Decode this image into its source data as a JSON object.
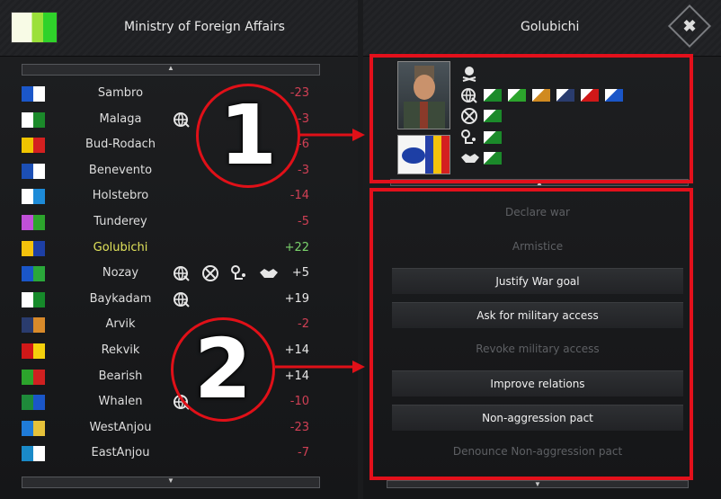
{
  "left_panel": {
    "title": "Ministry of Foreign Affairs"
  },
  "right_panel": {
    "title": "Golubichi",
    "close_label": "✖"
  },
  "countries": [
    {
      "name": "Sambro",
      "value": "-23",
      "sign": "neg",
      "flag_colors": [
        "#1b57c9",
        "#ffffff"
      ],
      "icons": []
    },
    {
      "name": "Malaga",
      "value": "-3",
      "sign": "neg",
      "flag_colors": [
        "#ffffff",
        "#1b8a2a"
      ],
      "icons": [
        "globe-icon"
      ]
    },
    {
      "name": "Bud-Rodach",
      "value": "-6",
      "sign": "neg",
      "flag_colors": [
        "#f0c400",
        "#d42020"
      ],
      "icons": []
    },
    {
      "name": "Benevento",
      "value": "-3",
      "sign": "neg",
      "flag_colors": [
        "#1c4fb5",
        "#ffffff"
      ],
      "icons": []
    },
    {
      "name": "Holstebro",
      "value": "-14",
      "sign": "neg",
      "flag_colors": [
        "#ffffff",
        "#1d8bd8"
      ],
      "icons": []
    },
    {
      "name": "Tunderey",
      "value": "-5",
      "sign": "neg",
      "flag_colors": [
        "#c050d8",
        "#2ca42c"
      ],
      "icons": []
    },
    {
      "name": "Golubichi",
      "value": "+22",
      "sign": "hl",
      "flag_colors": [
        "#f4c20c",
        "#1d3fa5"
      ],
      "icons": []
    },
    {
      "name": "Nozay",
      "value": "+5",
      "sign": "pos",
      "flag_colors": [
        "#1a56c8",
        "#2aa83a"
      ],
      "icons": [
        "globe-icon",
        "crossed-swords-icon",
        "access-pin-icon",
        "handshake-icon"
      ]
    },
    {
      "name": "Baykadam",
      "value": "+19",
      "sign": "pos",
      "flag_colors": [
        "#ffffff",
        "#168a2a"
      ],
      "icons": [
        "globe-icon"
      ]
    },
    {
      "name": "Arvik",
      "value": "-2",
      "sign": "neg",
      "flag_colors": [
        "#2a3c6e",
        "#d88a2a"
      ],
      "icons": []
    },
    {
      "name": "Rekvik",
      "value": "+14",
      "sign": "pos",
      "flag_colors": [
        "#d01818",
        "#f4d00c"
      ],
      "icons": []
    },
    {
      "name": "Bearish",
      "value": "+14",
      "sign": "pos",
      "flag_colors": [
        "#2ca42c",
        "#d02020"
      ],
      "icons": []
    },
    {
      "name": "Whalen",
      "value": "-10",
      "sign": "neg",
      "flag_colors": [
        "#1e8a3a",
        "#1a56c8"
      ],
      "icons": [
        "globe-icon"
      ]
    },
    {
      "name": "WestAnjou",
      "value": "-23",
      "sign": "neg",
      "flag_colors": [
        "#1f7bd8",
        "#e6c23a"
      ],
      "icons": []
    },
    {
      "name": "EastAnjou",
      "value": "-7",
      "sign": "neg",
      "flag_colors": [
        "#1a8ac8",
        "#ffffff"
      ],
      "icons": []
    }
  ],
  "relations_rows": [
    {
      "icon": "skull-icon",
      "flags": []
    },
    {
      "icon": "globe-icon",
      "flags": [
        "#1b8a2a",
        "#2ca42c",
        "#d08a20",
        "#2a3c6e",
        "#d01818",
        "#1a56c8"
      ]
    },
    {
      "icon": "crossed-swords-icon",
      "flags": [
        "#1b8a2a"
      ]
    },
    {
      "icon": "access-pin-icon",
      "flags": [
        "#1b8a2a"
      ]
    },
    {
      "icon": "handshake-icon",
      "flags": [
        "#1b8a2a"
      ]
    }
  ],
  "actions": [
    {
      "label": "Declare war",
      "enabled": false
    },
    {
      "label": "Armistice",
      "enabled": false
    },
    {
      "label": "Justify War goal",
      "enabled": true
    },
    {
      "label": "Ask for military access",
      "enabled": true
    },
    {
      "label": "Revoke military access",
      "enabled": false
    },
    {
      "label": "Improve relations",
      "enabled": true
    },
    {
      "label": "Non-aggression pact",
      "enabled": true
    },
    {
      "label": "Denounce Non-aggression pact",
      "enabled": false
    }
  ],
  "annotations": {
    "one": "1",
    "two": "2"
  },
  "colors": {
    "annotation_red": "#e3101b",
    "negative": "#d04055",
    "highlight_name": "#e2e35a",
    "highlight_value": "#7bd36c"
  }
}
